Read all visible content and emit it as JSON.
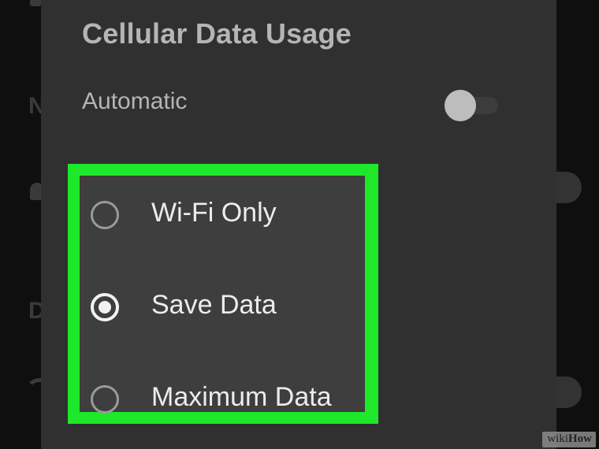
{
  "dialog": {
    "title": "Cellular Data Usage",
    "automatic_label": "Automatic",
    "automatic_enabled": false
  },
  "options": [
    {
      "label": "Wi-Fi Only",
      "selected": false
    },
    {
      "label": "Save Data",
      "selected": true
    },
    {
      "label": "Maximum Data",
      "selected": false
    }
  ],
  "highlight_color": "#1ee829",
  "background_letters": {
    "first": "N",
    "second": "D"
  },
  "watermark": {
    "prefix": "wiki",
    "suffix": "How"
  }
}
